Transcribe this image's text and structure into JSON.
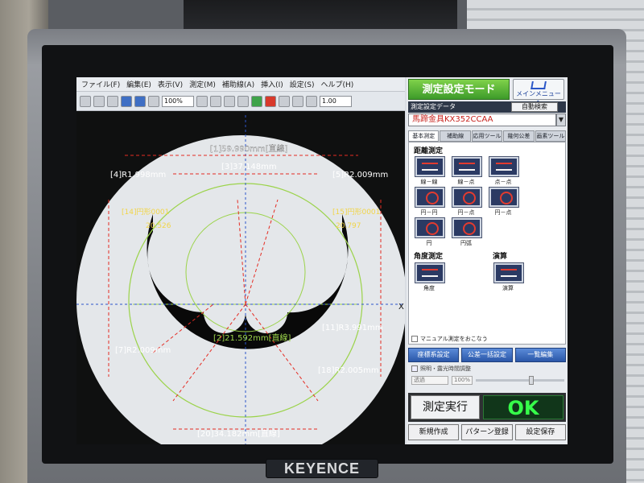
{
  "brand": "KEYENCE",
  "menubar": [
    "ファイル(F)",
    "編集(E)",
    "表示(V)",
    "測定(M)",
    "補助線(A)",
    "挿入(I)",
    "設定(S)",
    "ヘルプ(H)"
  ],
  "toolbar": {
    "zoom": "100%",
    "ratio": "1.00"
  },
  "panel": {
    "mode_title": "測定設定モード",
    "main_menu": "メインメニューへ",
    "data_header": "測定設定データ",
    "auto_search": "自動検索",
    "data_name": "馬蹄金具KX352CCAA",
    "tabs": [
      "基本測定",
      "補助線",
      "応用ツール",
      "幾何公差",
      "画素ツール"
    ],
    "distance_label": "距離測定",
    "tools": [
      "線－線",
      "線－点",
      "点－点",
      "円－円",
      "円－点",
      "円－点",
      "円",
      "円弧"
    ],
    "angle_label": "角度測定",
    "calc_label": "演算",
    "angle_tool": "角度",
    "calc_tool": "演算",
    "manual": "マニュアル測定をおこなう",
    "blue_buttons": [
      "座標系設定",
      "公差一括設定",
      "一覧編集"
    ],
    "light": "照明・露光時間調整",
    "light_mode": "透過",
    "light_pct": "100%",
    "exec": "測定実行",
    "result": "OK",
    "bottom_buttons": [
      "新規作成",
      "パターン登録",
      "設定保存"
    ]
  },
  "view": {
    "axis_x": "X",
    "axis_y": "Y",
    "labels": [
      "[1]59.990mm[直線]",
      "[3]37.148mm",
      "[4]R1.998mm",
      "[5]R2.009mm",
      "[7]R2.009mm",
      "[11]R3.991mm",
      "[2]21.592mm[直線]",
      "[18]R2.005mm",
      "[20]34.182mm[直線]",
      "[14]円形0001",
      "[15]円形0001",
      "20.526",
      "20.797"
    ]
  }
}
